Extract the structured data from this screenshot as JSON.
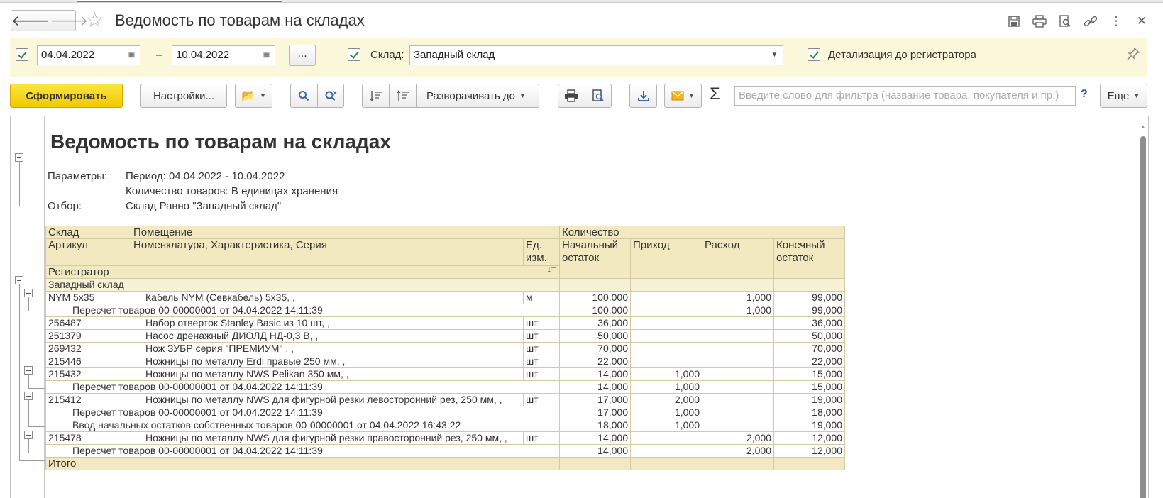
{
  "window": {
    "title": "Ведомость по товарам на складах"
  },
  "filters": {
    "date_from": "04.04.2022",
    "date_dash": "–",
    "date_to": "10.04.2022",
    "dots": "...",
    "warehouse_label": "Склад:",
    "warehouse_value": "Западный склад",
    "detail_label": "Детализация до регистратора"
  },
  "toolbar": {
    "generate": "Сформировать",
    "settings": "Настройки...",
    "expand_to": "Разворачивать до",
    "search_placeholder": "Введите слово для фильтра (название товара, покупателя и пр.)",
    "help": "?",
    "more": "Еще"
  },
  "report": {
    "title": "Ведомость по товарам на складах",
    "params_label": "Параметры:",
    "period": "Период: 04.04.2022 - 10.04.2022",
    "qty_mode": "Количество товаров: В единицах хранения",
    "filter_label": "Отбор:",
    "filter_value": "Склад Равно \"Западный склад\"",
    "headers": {
      "warehouse": "Склад",
      "room": "Помещение",
      "quantity": "Количество",
      "article": "Артикул",
      "nomenclature": "Номенклатура, Характеристика, Серия",
      "unit": "Ед. изм.",
      "opening": "Начальный остаток",
      "income": "Приход",
      "expense": "Расход",
      "closing": "Конечный остаток",
      "registrar": "Регистратор"
    },
    "group": "Западный склад",
    "rows": [
      {
        "type": "item",
        "article": "NYM 5x35",
        "name": "Кабель NYM (Севкабель) 5х35, ,",
        "unit": "м",
        "opening": "100,000",
        "income": "",
        "expense": "1,000",
        "closing": "99,000"
      },
      {
        "type": "doc",
        "name": "Пересчет товаров 00-00000001 от 04.04.2022 14:11:39",
        "opening": "100,000",
        "income": "",
        "expense": "1,000",
        "closing": "99,000"
      },
      {
        "type": "item",
        "article": "256487",
        "name": "Набор отверток Stanley Basic из 10 шт, ,",
        "unit": "шт",
        "opening": "36,000",
        "income": "",
        "expense": "",
        "closing": "36,000"
      },
      {
        "type": "item",
        "article": "251379",
        "name": "Насос дренажный ДИОЛД НД-0,3 В, ,",
        "unit": "шт",
        "opening": "50,000",
        "income": "",
        "expense": "",
        "closing": "50,000"
      },
      {
        "type": "item",
        "article": "269432",
        "name": "Нож ЗУБР серия \"ПРЕМИУМ\" , ,",
        "unit": "шт",
        "opening": "70,000",
        "income": "",
        "expense": "",
        "closing": "70,000"
      },
      {
        "type": "item",
        "article": "215446",
        "name": "Ножницы по металлу Erdi правые 250 мм, ,",
        "unit": "шт",
        "opening": "22,000",
        "income": "",
        "expense": "",
        "closing": "22,000"
      },
      {
        "type": "item",
        "article": "215432",
        "name": "Ножницы по металлу NWS Pelikan 350 мм, ,",
        "unit": "шт",
        "opening": "14,000",
        "income": "1,000",
        "expense": "",
        "closing": "15,000"
      },
      {
        "type": "doc",
        "name": "Пересчет товаров 00-00000001 от 04.04.2022 14:11:39",
        "opening": "14,000",
        "income": "1,000",
        "expense": "",
        "closing": "15,000"
      },
      {
        "type": "item",
        "article": "215412",
        "name": "Ножницы по металлу NWS для фигурной резки левосторонний рез, 250 мм, ,",
        "unit": "шт",
        "opening": "17,000",
        "income": "2,000",
        "expense": "",
        "closing": "19,000"
      },
      {
        "type": "doc",
        "name": "Пересчет товаров 00-00000001 от 04.04.2022 14:11:39",
        "opening": "17,000",
        "income": "1,000",
        "expense": "",
        "closing": "18,000"
      },
      {
        "type": "doc",
        "name": "Ввод начальных остатков собственных товаров 00-00000001 от 04.04.2022 16:43:22",
        "opening": "18,000",
        "income": "1,000",
        "expense": "",
        "closing": "19,000"
      },
      {
        "type": "item",
        "article": "215478",
        "name": "Ножницы по металлу NWS для фигурной резки правосторонний рез, 250 мм, ,",
        "unit": "шт",
        "opening": "14,000",
        "income": "",
        "expense": "2,000",
        "closing": "12,000"
      },
      {
        "type": "doc",
        "name": "Пересчет товаров 00-00000001 от 04.04.2022 14:11:39",
        "opening": "14,000",
        "income": "",
        "expense": "2,000",
        "closing": "12,000"
      }
    ],
    "total_label": "Итого"
  },
  "colors": {
    "filter_bg": "#fbf7da",
    "header_bg": "#f2e9c0",
    "primary": "#f1c800",
    "check": "#2e8b3a"
  }
}
